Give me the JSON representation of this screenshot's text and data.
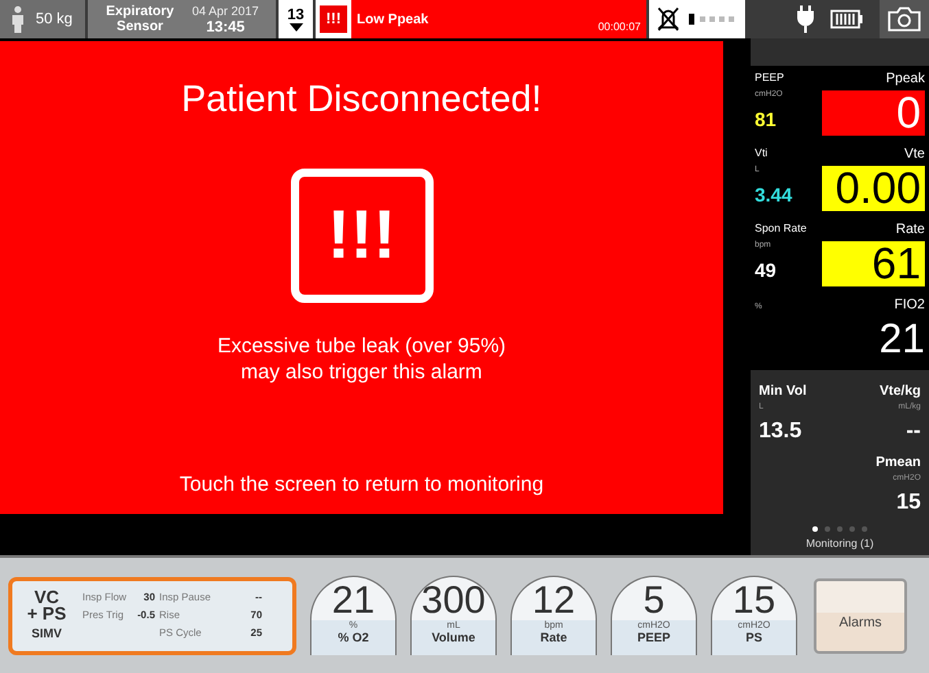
{
  "top_bar": {
    "weight": "50 kg",
    "sensor": "Expiratory Sensor",
    "date": "04 Apr 2017",
    "time": "13:45",
    "alarm_count": "13",
    "alarm_icon": "!!!",
    "alarm": "Low Ppeak",
    "alarm_timer": "00:00:07"
  },
  "alert": {
    "title": "Patient Disconnected!",
    "icon": "!!!",
    "message": [
      "Excessive tube leak (over 95%)",
      "may also trigger this alarm"
    ],
    "hint": "Touch the screen to return to monitoring"
  },
  "monitor": {
    "rows": [
      {
        "left": {
          "label": "PEEP",
          "unit": "cmH2O",
          "value": "81",
          "color": "#ffff33"
        },
        "right": {
          "label": "Ppeak",
          "value": "0",
          "color": "#ff0000"
        }
      },
      {
        "left": {
          "label": "Vti",
          "unit": "L",
          "value": "3.44",
          "color": "#33dddd"
        },
        "right": {
          "label": "Vte",
          "value": "0.00",
          "color": "#ffff00"
        }
      },
      {
        "left": {
          "label": "Spon Rate",
          "unit": "bpm",
          "value": "49",
          "color": "#ffffff"
        },
        "right": {
          "label": "Rate",
          "value": "61",
          "color": "#ffff00"
        }
      },
      {
        "left": {
          "unit": "%"
        },
        "right": {
          "label": "FIO2",
          "value": "21"
        }
      }
    ],
    "secondary": [
      {
        "label": "Min Vol",
        "unit": "L",
        "value": "13.5"
      },
      {
        "label": "Vte/kg",
        "unit": "mL/kg",
        "value": "--"
      },
      {
        "label": "Pmean",
        "unit": "cmH2O",
        "value": "15"
      }
    ],
    "pages": [
      {
        "selected": true
      },
      {
        "selected": false
      },
      {
        "selected": false
      },
      {
        "selected": false
      },
      {
        "selected": false
      }
    ],
    "page_label": "Monitoring (1)"
  },
  "mode": {
    "lines": [
      "VC",
      "+ PS",
      "SIMV"
    ],
    "params": [
      {
        "label": "Insp Flow",
        "value": "30"
      },
      {
        "label": "Insp Pause",
        "value": "--"
      },
      {
        "label": "Pres Trig",
        "value": "-0.5"
      },
      {
        "label": "Rise",
        "value": "70"
      },
      {
        "label": "PS Cycle",
        "value": "25"
      }
    ]
  },
  "settings": [
    {
      "value": "21",
      "unit": "%",
      "label": "% O2"
    },
    {
      "value": "300",
      "unit": "mL",
      "label": "Volume"
    },
    {
      "value": "12",
      "unit": "bpm",
      "label": "Rate"
    },
    {
      "value": "5",
      "unit": "cmH2O",
      "label": "PEEP"
    },
    {
      "value": "15",
      "unit": "cmH2O",
      "label": "PS"
    }
  ],
  "alarms_button": "Alarms"
}
